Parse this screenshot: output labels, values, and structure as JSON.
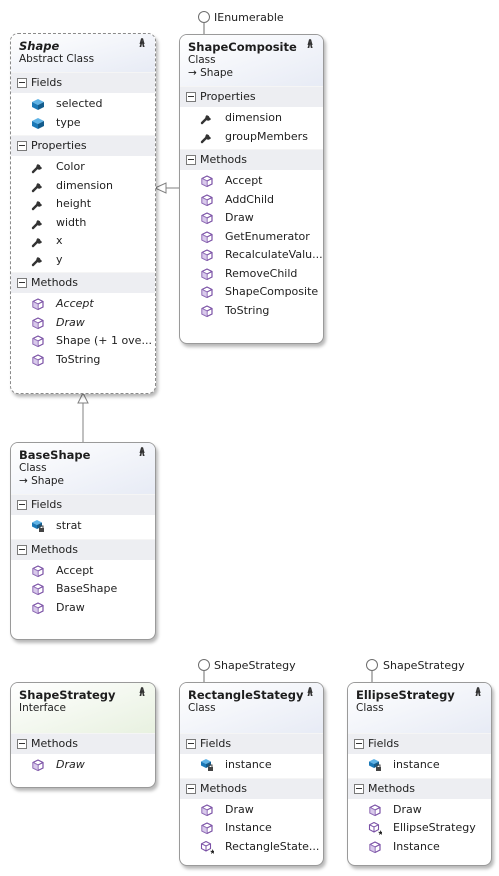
{
  "shape": {
    "title": "Shape",
    "stereotype": "Abstract Class",
    "fields_label": "Fields",
    "fields": [
      "selected",
      "type"
    ],
    "properties_label": "Properties",
    "properties": [
      "Color",
      "dimension",
      "height",
      "width",
      "x",
      "y"
    ],
    "methods_label": "Methods",
    "methods": [
      "Accept",
      "Draw",
      "Shape (+ 1 ove...",
      "ToString"
    ]
  },
  "shapeComposite": {
    "interface": "IEnumerable",
    "title": "ShapeComposite",
    "stereotype": "Class",
    "base": "Shape",
    "properties_label": "Properties",
    "properties": [
      "dimension",
      "groupMembers"
    ],
    "methods_label": "Methods",
    "methods": [
      "Accept",
      "AddChild",
      "Draw",
      "GetEnumerator",
      "RecalculateValu...",
      "RemoveChild",
      "ShapeComposite",
      "ToString"
    ]
  },
  "baseShape": {
    "title": "BaseShape",
    "stereotype": "Class",
    "base": "Shape",
    "fields_label": "Fields",
    "fields": [
      "strat"
    ],
    "methods_label": "Methods",
    "methods": [
      "Accept",
      "BaseShape",
      "Draw"
    ]
  },
  "shapeStrategy": {
    "title": "ShapeStrategy",
    "stereotype": "Interface",
    "methods_label": "Methods",
    "methods": [
      "Draw"
    ]
  },
  "rectangleStrategy": {
    "interface": "ShapeStrategy",
    "title": "RectangleStategy",
    "stereotype": "Class",
    "fields_label": "Fields",
    "fields": [
      "instance"
    ],
    "methods_label": "Methods",
    "methods": [
      "Draw",
      "Instance",
      "RectangleState..."
    ]
  },
  "ellipseStrategy": {
    "interface": "ShapeStrategy",
    "title": "EllipseStrategy",
    "stereotype": "Class",
    "fields_label": "Fields",
    "fields": [
      "instance"
    ],
    "methods_label": "Methods",
    "methods": [
      "Draw",
      "EllipseStrategy",
      "Instance"
    ]
  },
  "colors": {
    "class_header": "#e7ebf5",
    "interface_header": "#e8f1e0",
    "section_bg": "#edeef2",
    "field_icon": "#1b79b8",
    "method_icon": "#7b52a6",
    "property_icon": "#333333"
  },
  "icons": {
    "field": "field-icon",
    "private_field": "private-field-icon",
    "property": "property-wrench-icon",
    "method": "method-cube-icon",
    "constructor": "constructor-cube-star-icon",
    "inherit": "inherit-arrow-icon"
  }
}
